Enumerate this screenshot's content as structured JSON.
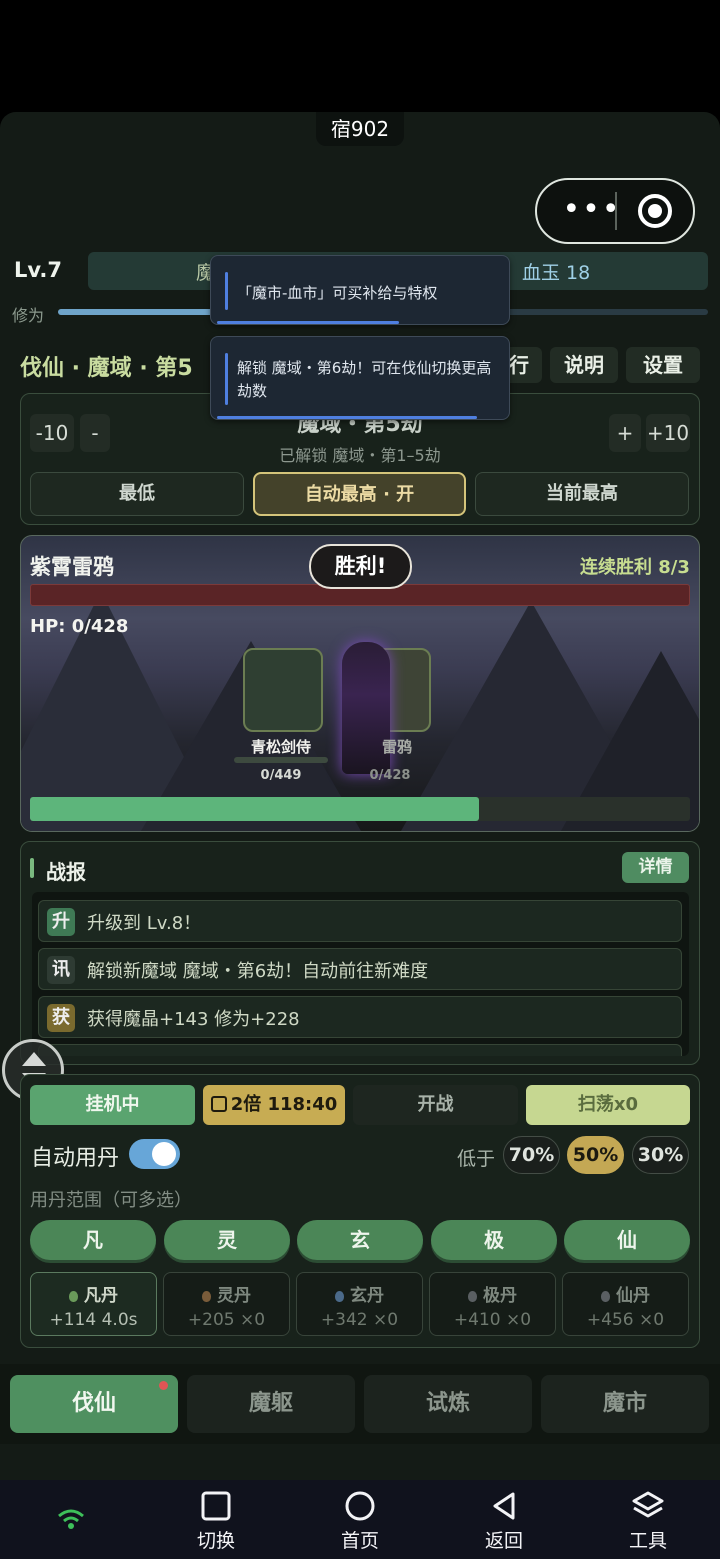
{
  "window": {
    "title": "宿902"
  },
  "player": {
    "level": "Lv.7",
    "resource_left": "魔",
    "resource_right": "血玉 18",
    "xiuwei_label": "修为"
  },
  "header": {
    "region": "伐仙 · 魔域 · 第5",
    "btn_partial": "行",
    "btn_explain": "说明",
    "btn_settings": "设置"
  },
  "toasts": [
    {
      "text": "「魔市-血市」可买补给与特权"
    },
    {
      "text": "解锁 魔域・第6劫！可在伐仙切换更高劫数"
    }
  ],
  "difficulty": {
    "minus10": "-10",
    "minus1": "-",
    "plus1": "+",
    "plus10": "+10",
    "title": "魔域・第5劫",
    "subtitle": "已解锁 魔域・第1–5劫",
    "modes": [
      "最低",
      "自动最高 · 开",
      "当前最高"
    ]
  },
  "battle": {
    "enemy": "紫霄雷鸦",
    "result": "胜利!",
    "streak": "连续胜利 8/3",
    "hp": "HP: 0/428",
    "ally": {
      "name": "青松剑侍",
      "hp": "0/449"
    },
    "foe": {
      "name": "雷鸦",
      "hp": "0/428"
    },
    "progress": 0.68
  },
  "report": {
    "title": "战报",
    "detail": "详情",
    "entries": [
      {
        "tag": "升",
        "text": "升级到 Lv.8！",
        "color": "#3f7a55"
      },
      {
        "tag": "讯",
        "text": "解锁新魔域 魔域・第6劫！自动前往新难度",
        "color": "#2e3b33"
      },
      {
        "tag": "获",
        "text": "获得魔晶+143 修为+228",
        "color": "#7a6a2e"
      }
    ]
  },
  "controls": {
    "idle": "挂机中",
    "double": "2倍 118:40",
    "fight": "开战",
    "sweep": "扫荡x0",
    "auto_dan": "自动用丹",
    "auto_on": true,
    "below": "低于",
    "percents": [
      "70%",
      "50%",
      "30%"
    ],
    "percent_selected": "50%",
    "range_label": "用丹范围（可多选）",
    "grades": [
      "凡",
      "灵",
      "玄",
      "极",
      "仙"
    ],
    "dans": [
      {
        "name": "凡丹",
        "value": "+114",
        "extra": "4.0s",
        "color": "#6a9a5a"
      },
      {
        "name": "灵丹",
        "value": "+205",
        "extra": "×0",
        "color": "#7a5c3a"
      },
      {
        "name": "玄丹",
        "value": "+342",
        "extra": "×0",
        "color": "#4b6a8a"
      },
      {
        "name": "极丹",
        "value": "+410",
        "extra": "×0",
        "color": "#5a5f62"
      },
      {
        "name": "仙丹",
        "value": "+456",
        "extra": "×0",
        "color": "#5a5f62"
      }
    ]
  },
  "tabs": [
    "伐仙",
    "魔躯",
    "试炼",
    "魔市"
  ],
  "sysnav": [
    "切换",
    "首页",
    "返回",
    "工具"
  ]
}
